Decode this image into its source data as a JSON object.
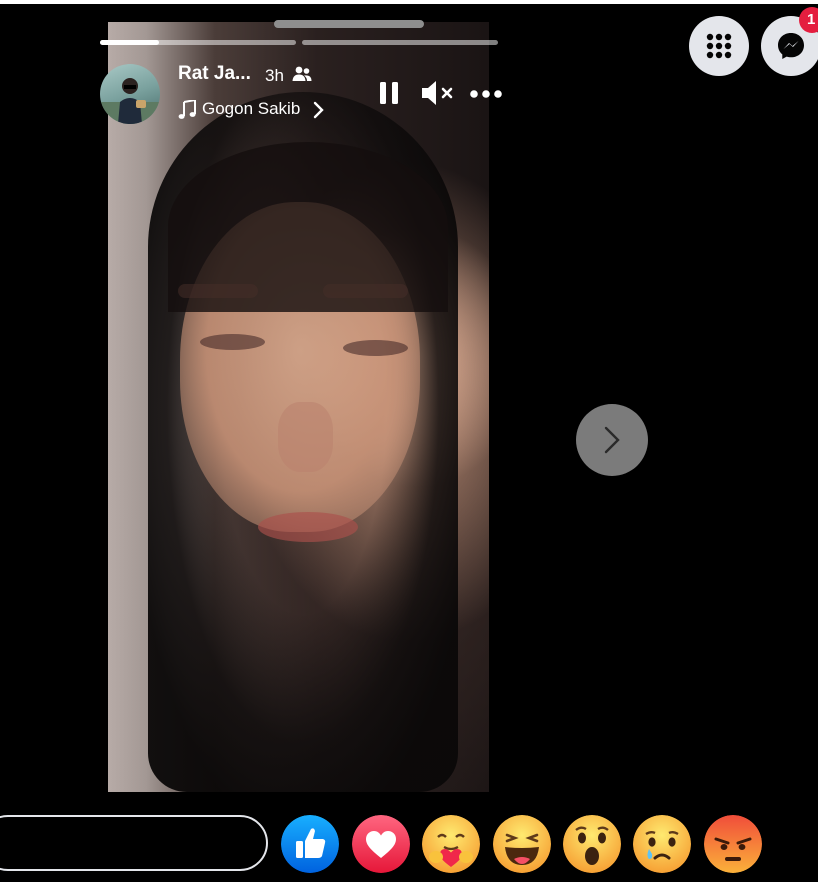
{
  "story": {
    "author": "Rat Ja...",
    "time": "3h",
    "audience_icon": "friends-icon",
    "song": "Gogon Sakib",
    "progress": [
      {
        "segment": 1,
        "filled_fraction": 0.3
      },
      {
        "segment": 2,
        "filled_fraction": 0
      }
    ]
  },
  "controls": {
    "pause_icon": "pause-icon",
    "mute_icon": "volume-muted-icon",
    "more_icon": "more-icon",
    "next_icon": "chevron-right-icon"
  },
  "header": {
    "menu_icon": "menu-grid-icon",
    "messenger_icon": "messenger-icon",
    "messenger_badge": "1"
  },
  "reply": {
    "placeholder": ""
  },
  "reactions": [
    {
      "name": "like",
      "color": "#1877f2"
    },
    {
      "name": "love",
      "color": "#f0284a"
    },
    {
      "name": "care",
      "color": "#f7b125"
    },
    {
      "name": "haha",
      "color": "#f7b125"
    },
    {
      "name": "wow",
      "color": "#f7b125"
    },
    {
      "name": "sad",
      "color": "#f7b125"
    },
    {
      "name": "angry",
      "color": "#e9710f"
    }
  ]
}
